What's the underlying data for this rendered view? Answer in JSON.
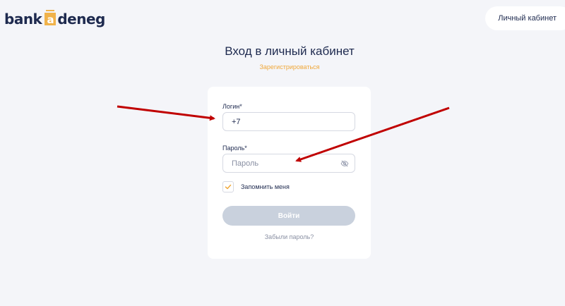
{
  "header": {
    "logo": {
      "text_before": "bank",
      "box_letter": "a",
      "text_after": "deneg"
    },
    "cabinet_button": "Личный кабинет"
  },
  "title": "Вход в личный кабинет",
  "register_link": "Зарегистрироваться",
  "form": {
    "login": {
      "label": "Логин*",
      "value": "+7"
    },
    "password": {
      "label": "Пароль*",
      "placeholder": "Пароль",
      "value": ""
    },
    "remember_me": {
      "label": "Запомнить меня",
      "checked": true
    },
    "submit_label": "Войти",
    "forgot_link": "Забыли пароль?"
  },
  "colors": {
    "accent": "#f0a83a",
    "brand_dark": "#1e2a4f",
    "button_disabled": "#c9d1dd",
    "annotation_arrow": "#c00000"
  },
  "icons": {
    "checkbox": "checkmark-icon",
    "password_toggle": "eye-off-icon"
  }
}
